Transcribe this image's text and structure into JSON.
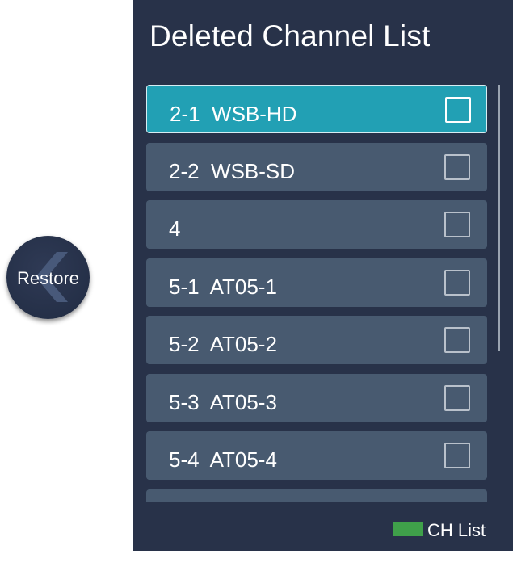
{
  "restore": {
    "label": "Restore",
    "icon": "chevron-left-icon"
  },
  "panel": {
    "title": "Deleted Channel List",
    "channels": [
      {
        "number": "2-1",
        "name": "WSB-HD",
        "checked": false,
        "selected": true
      },
      {
        "number": "2-2",
        "name": "WSB-SD",
        "checked": false,
        "selected": false
      },
      {
        "number": "4",
        "name": "",
        "checked": false,
        "selected": false
      },
      {
        "number": "5-1",
        "name": "AT05-1",
        "checked": false,
        "selected": false
      },
      {
        "number": "5-2",
        "name": "AT05-2",
        "checked": false,
        "selected": false
      },
      {
        "number": "5-3",
        "name": "AT05-3",
        "checked": false,
        "selected": false
      },
      {
        "number": "5-4",
        "name": "AT05-4",
        "checked": false,
        "selected": false
      },
      {
        "number": "",
        "name": "",
        "checked": false,
        "selected": false
      }
    ]
  },
  "footer": {
    "key_label": "CH List",
    "key_color": "#3fa04a"
  },
  "colors": {
    "panel_bg": "#283249",
    "row_bg": "#485a70",
    "selected_row_bg": "#22a0b4",
    "restore_bg": "#253048"
  }
}
